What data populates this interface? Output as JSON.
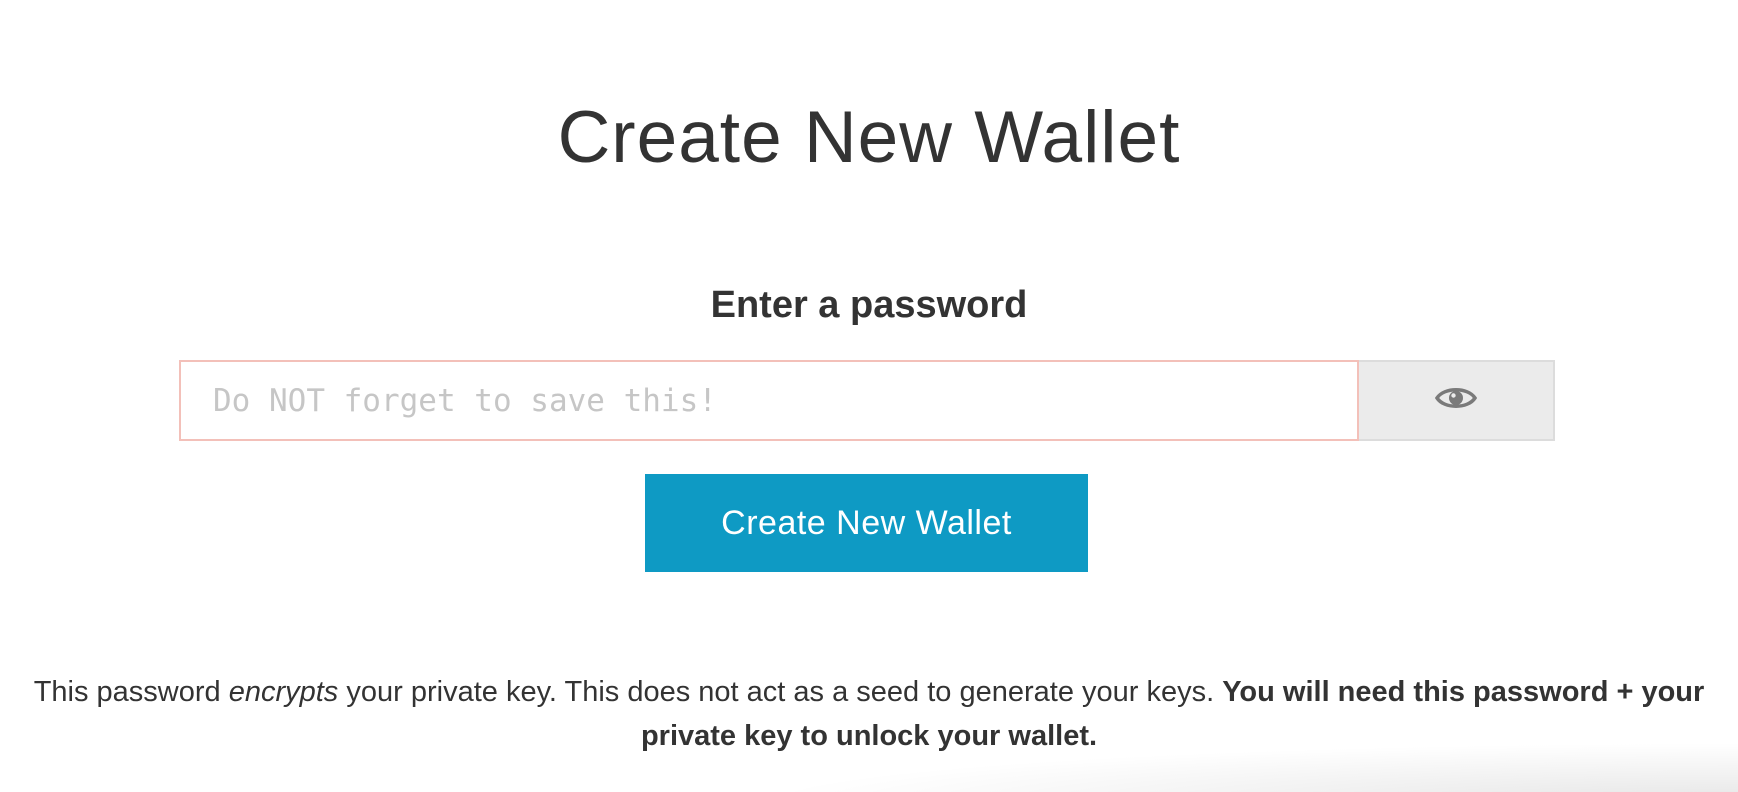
{
  "page": {
    "title": "Create New Wallet"
  },
  "password_section": {
    "heading": "Enter a password",
    "input_placeholder": "Do NOT forget to save this!",
    "input_value": "",
    "toggle_icon": "eye-icon"
  },
  "actions": {
    "create_label": "Create New Wallet"
  },
  "note": {
    "text_1": "This password ",
    "emphasis": "encrypts",
    "text_2": " your private key. This does not act as a seed to generate your keys. ",
    "bold": "You will need this password + your private key to unlock your wallet."
  },
  "colors": {
    "accent": "#0e9ac4",
    "input_border": "#f3c0b9",
    "toggle_bg": "#ebebeb"
  }
}
